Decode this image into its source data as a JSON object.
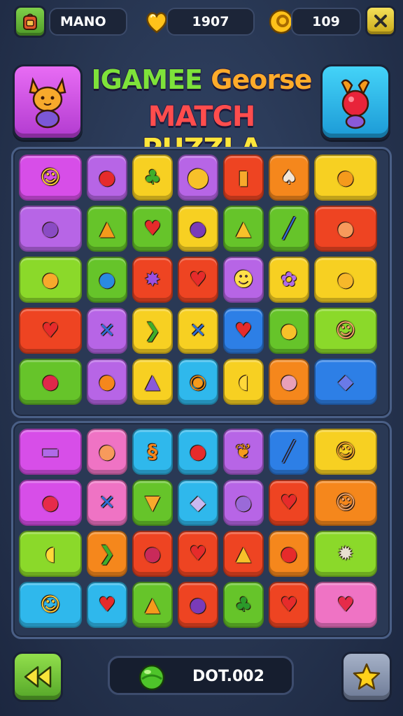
{
  "top_bar": {
    "player_name": "MANO",
    "lives_count": "1907",
    "coins_count": "109"
  },
  "header": {
    "title_line1_a": "IGAMEE",
    "title_line1_b": "Georse",
    "title_line2_a": "MATCH",
    "title_line2_b": "PUZZLA"
  },
  "bottom_bar": {
    "score_label": "DOT.002"
  },
  "colors": {
    "magenta": "#d74ee8",
    "purple": "#b765e6",
    "yellow": "#f7d022",
    "orange": "#f5871c",
    "red": "#ee4422",
    "green": "#66c42a",
    "lime": "#8bd92a",
    "cyan": "#2fb8ec",
    "blue": "#2d7fe6",
    "pink": "#ef73c4"
  },
  "board_top": [
    [
      {
        "c": "magenta",
        "i": "lemon-face-icon",
        "w": 1
      },
      {
        "c": "purple",
        "i": "apple-icon"
      },
      {
        "c": "yellow",
        "i": "broccoli-icon"
      },
      {
        "c": "purple",
        "i": "pin-icon"
      },
      {
        "c": "red",
        "i": "jar-icon"
      },
      {
        "c": "orange",
        "i": "mushroom-icon"
      },
      {
        "c": "yellow",
        "i": "bird-icon",
        "w": 1
      }
    ],
    [
      {
        "c": "purple",
        "i": "pot-icon",
        "w": 1
      },
      {
        "c": "green",
        "i": "carrot-icon"
      },
      {
        "c": "green",
        "i": "strawberry-icon"
      },
      {
        "c": "yellow",
        "i": "plum-icon"
      },
      {
        "c": "green",
        "i": "pepper-icon"
      },
      {
        "c": "green",
        "i": "blade-icon"
      },
      {
        "c": "red",
        "i": "peach-icon",
        "w": 1
      }
    ],
    [
      {
        "c": "lime",
        "i": "lemon-icon",
        "w": 1
      },
      {
        "c": "green",
        "i": "bottle-icon"
      },
      {
        "c": "red",
        "i": "star-icon"
      },
      {
        "c": "red",
        "i": "heart-leaf-icon"
      },
      {
        "c": "purple",
        "i": "skull-icon"
      },
      {
        "c": "yellow",
        "i": "flower-icon"
      },
      {
        "c": "yellow",
        "i": "chick-icon",
        "w": 1
      }
    ],
    [
      {
        "c": "red",
        "i": "heart-icon",
        "w": 1
      },
      {
        "c": "purple",
        "i": "cross-icon"
      },
      {
        "c": "yellow",
        "i": "chili-icon"
      },
      {
        "c": "yellow",
        "i": "cross-icon"
      },
      {
        "c": "blue",
        "i": "strawberry-icon"
      },
      {
        "c": "green",
        "i": "bell-pepper-icon"
      },
      {
        "c": "lime",
        "i": "smiley-icon",
        "w": 1
      }
    ],
    [
      {
        "c": "green",
        "i": "watermelon-icon",
        "w": 1
      },
      {
        "c": "purple",
        "i": "orange-icon"
      },
      {
        "c": "yellow",
        "i": "drop-icon"
      },
      {
        "c": "cyan",
        "i": "citrus-icon"
      },
      {
        "c": "yellow",
        "i": "banana-icon"
      },
      {
        "c": "orange",
        "i": "onion-icon"
      },
      {
        "c": "blue",
        "i": "fish-icon",
        "w": 1
      }
    ]
  ],
  "board_bottom": [
    [
      {
        "c": "magenta",
        "i": "basket-icon",
        "w": 1
      },
      {
        "c": "pink",
        "i": "peach-icon"
      },
      {
        "c": "cyan",
        "i": "shrimp-icon"
      },
      {
        "c": "cyan",
        "i": "apple-icon"
      },
      {
        "c": "purple",
        "i": "leaf-icon"
      },
      {
        "c": "blue",
        "i": "blade-icon"
      },
      {
        "c": "yellow",
        "i": "pineapple-icon",
        "w": 1
      }
    ],
    [
      {
        "c": "magenta",
        "i": "candy-icon",
        "w": 1
      },
      {
        "c": "pink",
        "i": "cross-icon"
      },
      {
        "c": "green",
        "i": "cupcake-icon"
      },
      {
        "c": "cyan",
        "i": "fish-bone-icon"
      },
      {
        "c": "purple",
        "i": "eggplant-icon"
      },
      {
        "c": "red",
        "i": "heart-icon"
      },
      {
        "c": "orange",
        "i": "smiley-icon",
        "w": 1
      }
    ],
    [
      {
        "c": "lime",
        "i": "banana-icon",
        "w": 1
      },
      {
        "c": "orange",
        "i": "chili-icon"
      },
      {
        "c": "red",
        "i": "beet-icon"
      },
      {
        "c": "red",
        "i": "heart-icon"
      },
      {
        "c": "red",
        "i": "pepper-icon"
      },
      {
        "c": "orange",
        "i": "apple-icon"
      },
      {
        "c": "lime",
        "i": "hedgehog-icon",
        "w": 1
      }
    ],
    [
      {
        "c": "cyan",
        "i": "lemon-face-icon",
        "w": 1
      },
      {
        "c": "cyan",
        "i": "strawberry-icon"
      },
      {
        "c": "green",
        "i": "carrot-icon"
      },
      {
        "c": "red",
        "i": "plum-icon"
      },
      {
        "c": "green",
        "i": "palm-icon"
      },
      {
        "c": "red",
        "i": "heart-icon"
      },
      {
        "c": "pink",
        "i": "balloon-icon",
        "w": 1
      }
    ]
  ]
}
